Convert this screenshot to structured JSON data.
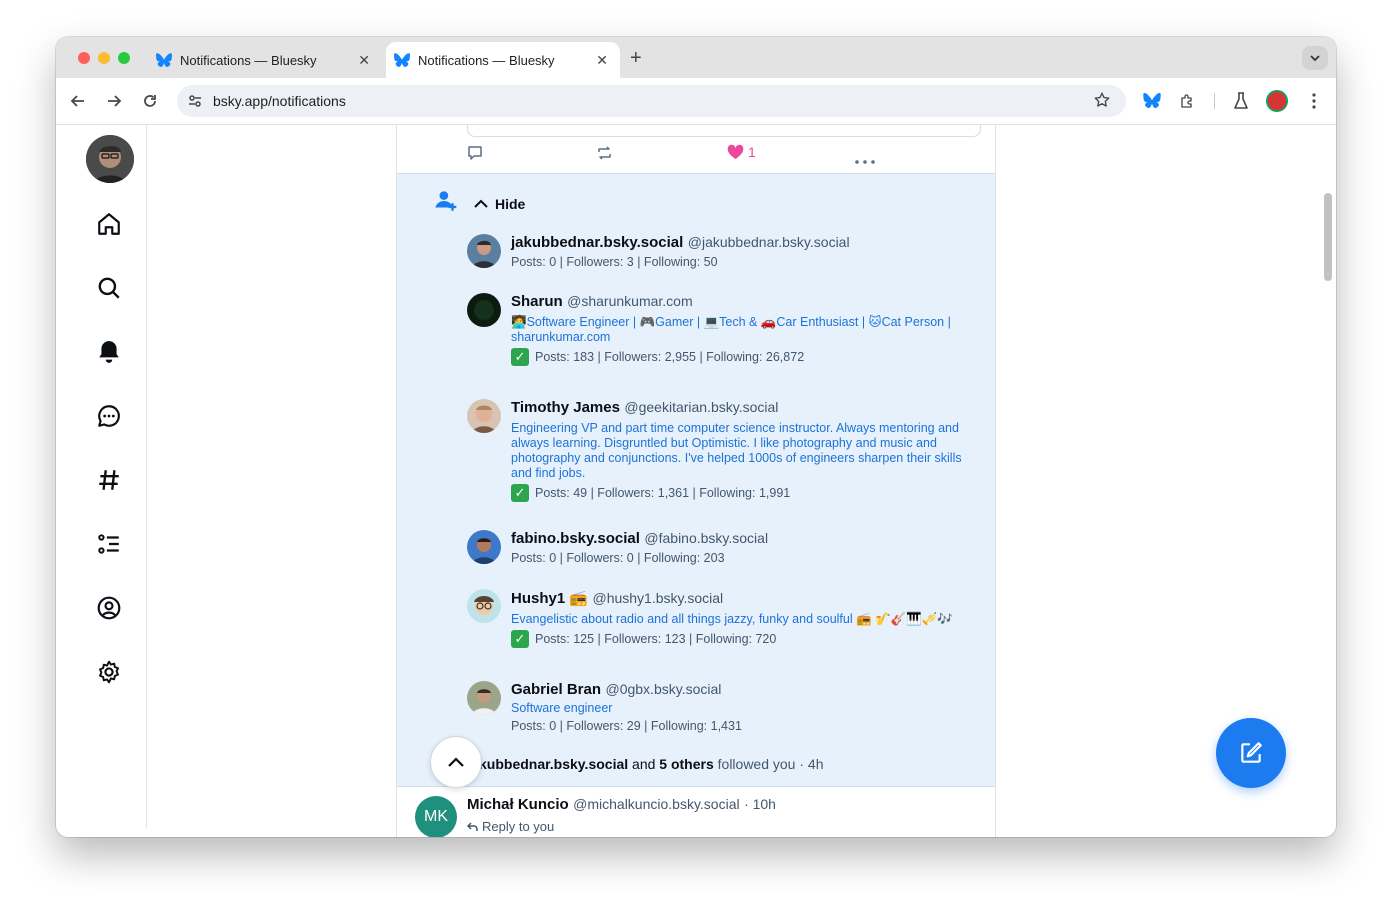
{
  "browser": {
    "tabs": [
      {
        "title": "Notifications — Bluesky",
        "close": "✕"
      },
      {
        "title": "Notifications — Bluesky",
        "close": "✕"
      }
    ],
    "new_tab": "+",
    "url": "bsky.app/notifications"
  },
  "post_actions": {
    "likes": "1"
  },
  "group": {
    "hide_label": "Hide",
    "footer_name": "kubbednar.bsky.social",
    "footer_and": "and",
    "footer_others": "5 others",
    "footer_rest": "followed you · 4h"
  },
  "users": [
    {
      "name": "jakubbednar.bsky.social",
      "handle": "@jakubbednar.bsky.social",
      "bio": "",
      "verified": false,
      "stats": "Posts: 0 | Followers: 3 | Following: 50"
    },
    {
      "name": "Sharun",
      "handle": "@sharunkumar.com",
      "bio": "🧑‍💻Software Engineer | 🎮Gamer | 💻Tech & 🚗Car Enthusiast | 🐱Cat Person | sharunkumar.com",
      "verified": true,
      "stats": "Posts: 183 | Followers: 2,955 | Following: 26,872"
    },
    {
      "name": "Timothy James",
      "handle": "@geekitarian.bsky.social",
      "bio": "Engineering VP and part time computer science instructor. Always mentoring and always learning. Disgruntled but Optimistic. I like photography and music and photography and conjunctions. I've helped 1000s of engineers sharpen their skills and find jobs.",
      "verified": true,
      "stats": "Posts: 49 | Followers: 1,361 | Following: 1,991"
    },
    {
      "name": "fabino.bsky.social",
      "handle": "@fabino.bsky.social",
      "bio": "",
      "verified": false,
      "stats": "Posts: 0 | Followers: 0 | Following: 203"
    },
    {
      "name": "Hushy1 📻",
      "handle": "@hushy1.bsky.social",
      "bio": "Evangelistic about radio and all things jazzy, funky and soulful 📻 🎷🎸🎹🎺🎶",
      "verified": true,
      "stats": "Posts: 125 | Followers: 123 | Following: 720"
    },
    {
      "name": "Gabriel Bran",
      "handle": "@0gbx.bsky.social",
      "bio": "Software engineer",
      "verified": false,
      "stats": "Posts: 0 | Followers: 29 | Following: 1,431"
    }
  ],
  "next_notif": {
    "avatar_text": "MK",
    "name": "Michał Kuncio",
    "handle": "@michalkuncio.bsky.social",
    "time": "· 10h",
    "reply": "Reply to you"
  },
  "check_mark": "✓",
  "colors": {
    "accent": "#1d7bf0",
    "like": "#ec4899",
    "highlight": "#e7f1fc"
  }
}
